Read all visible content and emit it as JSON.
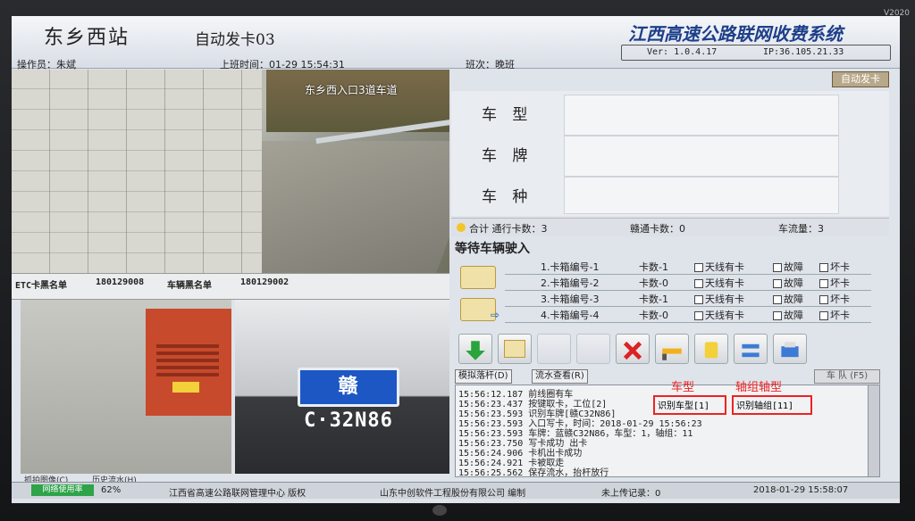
{
  "monitor": {
    "label": "V2020"
  },
  "header": {
    "station": "东乡西站",
    "lane": "自动发卡03",
    "system_title": "江西高速公路联网收费系统",
    "version": "Ver: 1.0.4.17",
    "ip": "IP:36.105.21.33",
    "operator": "操作员：朱斌",
    "shift_time": "上班时间：01-29 15:54:31",
    "shift": "班次：晚班",
    "mode_button": "自动发卡"
  },
  "camera": {
    "top_label": "东乡西入口3道车道",
    "plate": "赣C·32N86",
    "capture_button": "抓拍图像(C)",
    "history_button": "历史流水(H)"
  },
  "blacklist": {
    "etc_label": "ETC卡黑名单",
    "etc_value": "180129008",
    "vehicle_label": "车辆黑名单",
    "vehicle_value": "180129002"
  },
  "vehicle_info": {
    "type_label": "车 型",
    "plate_label": "车 牌",
    "category_label": "车 种"
  },
  "counts": {
    "total": "合计 通行卡数：3",
    "ganTong": "赣通卡数：0",
    "flow": "车流量：3"
  },
  "waiting_title": "等待车辆驶入",
  "bins": [
    {
      "no": "1.卡箱编号-1",
      "count": "卡数-1",
      "antenna": "天线有卡",
      "fault": "故障",
      "bad": "坏卡"
    },
    {
      "no": "2.卡箱编号-2",
      "count": "卡数-0",
      "antenna": "天线有卡",
      "fault": "故障",
      "bad": "坏卡"
    },
    {
      "no": "3.卡箱编号-3",
      "count": "卡数-1",
      "antenna": "天线有卡",
      "fault": "故障",
      "bad": "坏卡"
    },
    {
      "no": "4.卡箱编号-4",
      "count": "卡数-0",
      "antenna": "天线有卡",
      "fault": "故障",
      "bad": "坏卡"
    }
  ],
  "buttons": {
    "sim_gate": "模拟落杆(D)",
    "flow_view": "流水查看(R)",
    "queue": "车 队 (F5)"
  },
  "log": [
    "15:56:12.187 前线圈有车",
    "15:56:23.437 按键取卡，工位[2]",
    "15:56:23.593 识别车牌[赣C32N86]",
    "15:56:23.593 入口写卡，时间：2018-01-29 15:56:23",
    "15:56:23.593 车牌：蓝赣C32N86，车型：1，轴组：11",
    "15:56:23.750 写卡成功 出卡",
    "15:56:24.906 卡机出卡成功",
    "15:56:24.921 卡被取走",
    "15:56:25.562 保存流水，抬杆放行"
  ],
  "annotations": {
    "type_tag": "识别车型[1]",
    "axle_tag": "识别轴组[11]",
    "type_caption": "车型",
    "axle_caption": "轴组轴型"
  },
  "statusbar": {
    "net": "网络使用率",
    "percent": "62%",
    "center": "江西省高速公路联网管理中心 版权",
    "company": "山东中创软件工程股份有限公司 编制",
    "upload": "未上传记录：0",
    "datetime": "2018-01-29 15:58:07"
  },
  "colors": {
    "title_blue": "#1d3f8a",
    "accent_red": "#e22222",
    "plate_blue": "#1d57c4"
  }
}
